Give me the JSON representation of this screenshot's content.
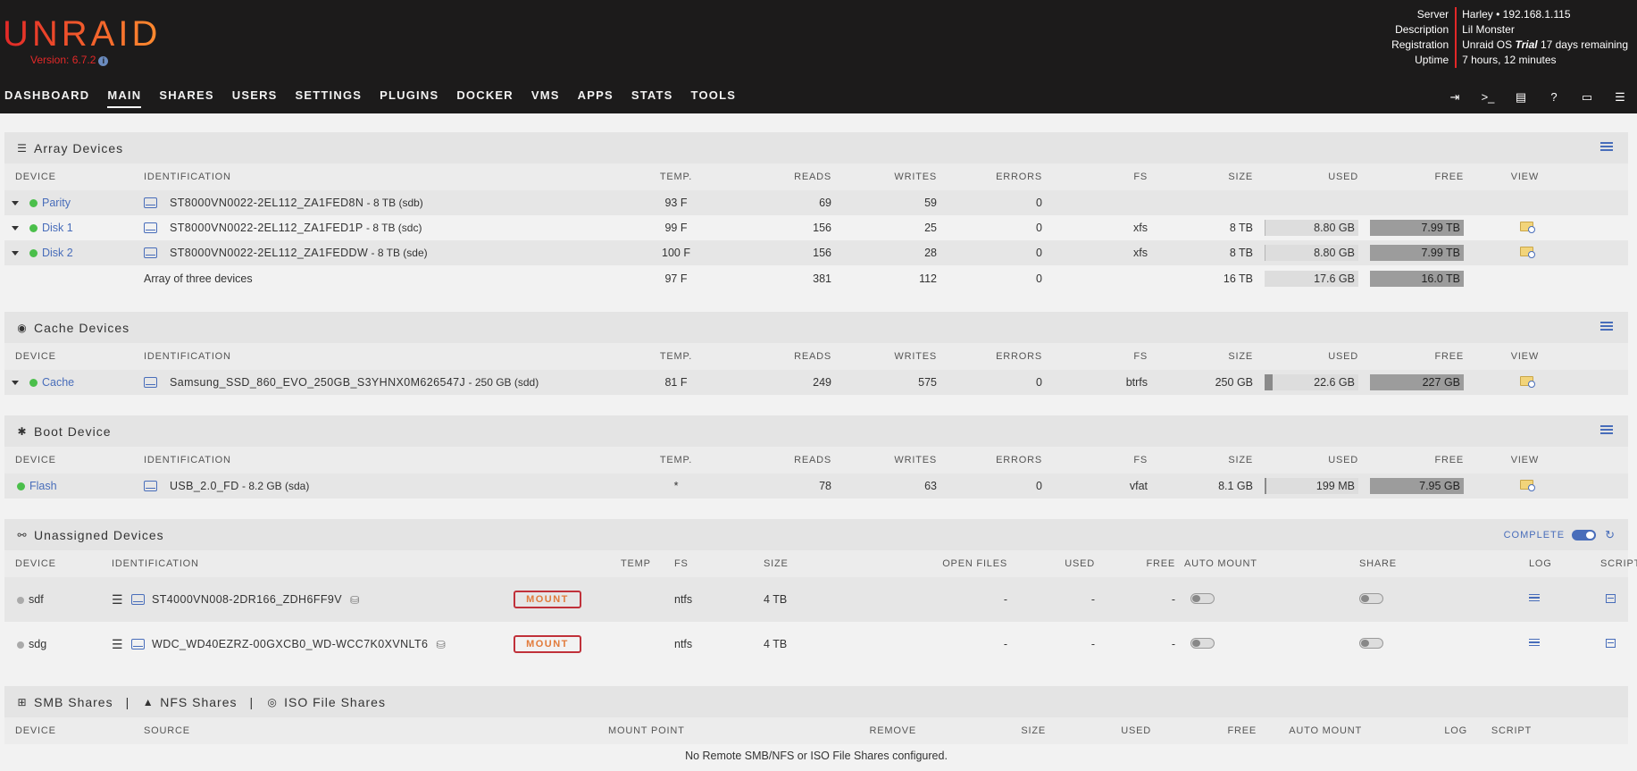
{
  "header": {
    "logo": "UNRAID",
    "version": "Version: 6.7.2",
    "nav": [
      "DASHBOARD",
      "MAIN",
      "SHARES",
      "USERS",
      "SETTINGS",
      "PLUGINS",
      "DOCKER",
      "VMS",
      "APPS",
      "STATS",
      "TOOLS"
    ],
    "active_nav": "MAIN",
    "server_info": {
      "labels": [
        "Server",
        "Description",
        "Registration",
        "Uptime"
      ],
      "server": "Harley • 192.168.1.115",
      "description": "Lil Monster",
      "registration_prefix": "Unraid OS ",
      "registration_trial": "Trial",
      "registration_suffix": " 17 days remaining",
      "uptime": "7 hours, 12 minutes"
    },
    "nav_icons": [
      "logout-icon",
      "terminal-icon",
      "feedback-icon",
      "help-icon",
      "monitor-icon",
      "log-icon"
    ]
  },
  "columns": {
    "device": "DEVICE",
    "identification": "IDENTIFICATION",
    "temp": "TEMP.",
    "reads": "READS",
    "writes": "WRITES",
    "errors": "ERRORS",
    "fs": "FS",
    "size": "SIZE",
    "used": "USED",
    "free": "FREE",
    "view": "VIEW"
  },
  "array": {
    "title": "Array Devices",
    "rows": [
      {
        "name": "Parity",
        "id": "ST8000VN0022-2EL112_ZA1FED8N",
        "size_info": " - 8 TB (sdb)",
        "temp": "93 F",
        "reads": "69",
        "writes": "59",
        "errors": "0",
        "fs": "",
        "size": "",
        "used": "",
        "free": "",
        "used_frac": 0,
        "free_frac": 0
      },
      {
        "name": "Disk 1",
        "id": "ST8000VN0022-2EL112_ZA1FED1P",
        "size_info": " - 8 TB (sdc)",
        "temp": "99 F",
        "reads": "156",
        "writes": "25",
        "errors": "0",
        "fs": "xfs",
        "size": "8 TB",
        "used": "8.80 GB",
        "free": "7.99 TB",
        "used_frac": 0.01,
        "free_frac": 0.99
      },
      {
        "name": "Disk 2",
        "id": "ST8000VN0022-2EL112_ZA1FEDDW",
        "size_info": " - 8 TB (sde)",
        "temp": "100 F",
        "reads": "156",
        "writes": "28",
        "errors": "0",
        "fs": "xfs",
        "size": "8 TB",
        "used": "8.80 GB",
        "free": "7.99 TB",
        "used_frac": 0.01,
        "free_frac": 0.99
      }
    ],
    "summary": {
      "label": "Array of three devices",
      "temp": "97 F",
      "reads": "381",
      "writes": "112",
      "errors": "0",
      "size": "16 TB",
      "used": "17.6 GB",
      "free": "16.0 TB"
    }
  },
  "cache": {
    "title": "Cache Devices",
    "row": {
      "name": "Cache",
      "id": "Samsung_SSD_860_EVO_250GB_S3YHNX0M626547J",
      "size_info": " - 250 GB (sdd)",
      "temp": "81 F",
      "reads": "249",
      "writes": "575",
      "errors": "0",
      "fs": "btrfs",
      "size": "250 GB",
      "used": "22.6 GB",
      "free": "227 GB",
      "used_frac": 0.09
    }
  },
  "boot": {
    "title": "Boot Device",
    "row": {
      "name": "Flash",
      "id": "USB_2.0_FD",
      "size_info": " - 8.2 GB (sda)",
      "temp": "*",
      "reads": "78",
      "writes": "63",
      "errors": "0",
      "fs": "vfat",
      "size": "8.1 GB",
      "used": "199 MB",
      "free": "7.95 GB",
      "used_frac": 0.02
    }
  },
  "unassigned": {
    "title": "Unassigned Devices",
    "complete_label": "COMPLETE",
    "columns": {
      "device": "DEVICE",
      "identification": "IDENTIFICATION",
      "temp": "TEMP",
      "fs": "FS",
      "size": "SIZE",
      "open_files": "OPEN FILES",
      "used": "USED",
      "free": "FREE",
      "auto_mount": "AUTO MOUNT",
      "share": "SHARE",
      "log": "LOG",
      "script": "SCRIPT"
    },
    "rows": [
      {
        "name": "sdf",
        "id": "ST4000VN008-2DR166_ZDH6FF9V",
        "mount": "MOUNT",
        "fs": "ntfs",
        "size": "4 TB",
        "open_files": "-",
        "used": "-",
        "free": "-"
      },
      {
        "name": "sdg",
        "id": "WDC_WD40EZRZ-00GXCB0_WD-WCC7K0XVNLT6",
        "mount": "MOUNT",
        "fs": "ntfs",
        "size": "4 TB",
        "open_files": "-",
        "used": "-",
        "free": "-"
      }
    ]
  },
  "shares": {
    "tab_smb": "SMB Shares",
    "tab_nfs": "NFS Shares",
    "tab_iso": "ISO File Shares",
    "sep": "|",
    "columns": {
      "device": "DEVICE",
      "source": "SOURCE",
      "mount_point": "MOUNT POINT",
      "remove": "REMOVE",
      "size": "SIZE",
      "used": "USED",
      "free": "FREE",
      "auto_mount": "AUTO MOUNT",
      "log": "LOG",
      "script": "SCRIPT"
    },
    "empty": "No Remote SMB/NFS or ISO File Shares configured."
  }
}
